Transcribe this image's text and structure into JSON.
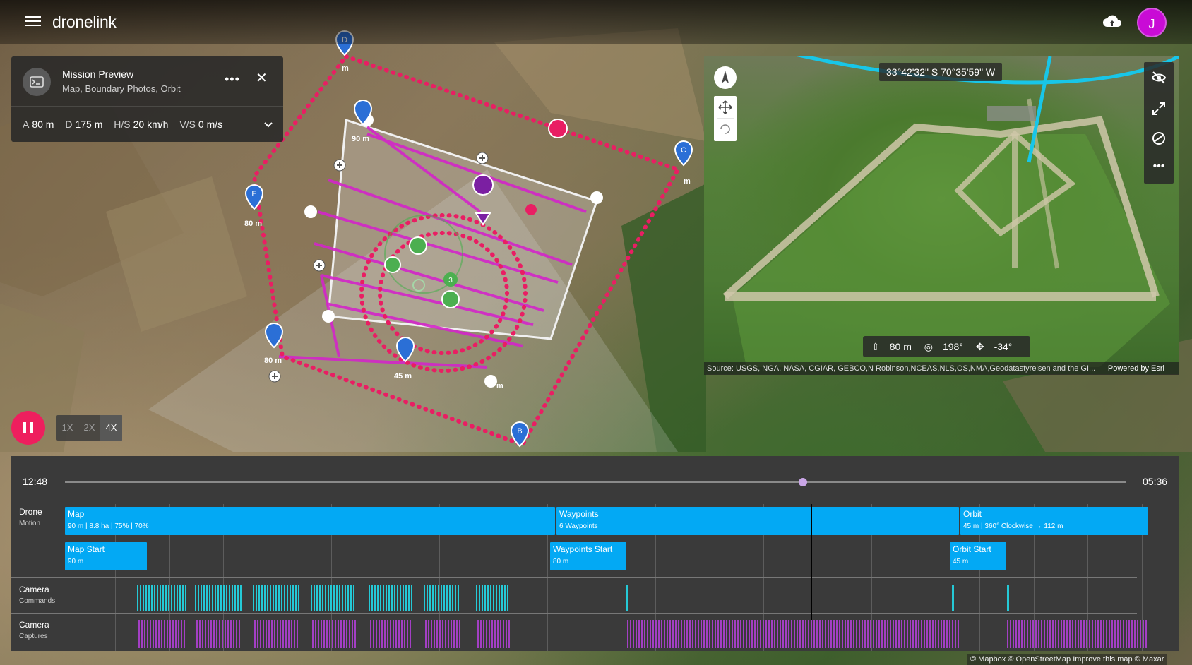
{
  "app": {
    "brand": "dronelink",
    "avatar_initial": "J",
    "colors": {
      "accent": "#03a9f4",
      "route": "#e91e63",
      "path": "#c02bd8",
      "pause": "#ee1f5e",
      "avatar": "#c90bd6"
    }
  },
  "mission": {
    "title": "Mission Preview",
    "subtitle": "Map, Boundary Photos, Orbit",
    "stats": [
      {
        "key": "A",
        "value": "80 m"
      },
      {
        "key": "D",
        "value": "175 m"
      },
      {
        "key": "H/S",
        "value": "20 km/h"
      },
      {
        "key": "V/S",
        "value": "0 m/s"
      }
    ]
  },
  "map": {
    "labels": {
      "m1": "m",
      "m2": "90 m",
      "m3": "80 m",
      "m4": "80 m",
      "m5": "45 m",
      "m6": "m",
      "m7": "m"
    },
    "markers": [
      "D",
      "C",
      "E",
      "B"
    ],
    "orbit_number": "3",
    "attribution": "© Mapbox © OpenStreetMap Improve this map © Maxar"
  },
  "preview": {
    "coords": "33°42'32\" S 70°35'59\" W",
    "hud": {
      "altitude": "80 m",
      "heading": "198°",
      "gimbal": "-34°"
    },
    "attribution_left": "Source: USGS, NGA, NASA, CGIAR, GEBCO,N Robinson,NCEAS,NLS,OS,NMA,Geodatastyrelsen and the GI...",
    "attribution_right": "Powered by Esri"
  },
  "playback": {
    "speeds": [
      "1X",
      "2X",
      "4X"
    ],
    "active_speed": "4X",
    "time_elapsed": "12:48",
    "time_total": "05:36",
    "progress": 0.696
  },
  "timeline": {
    "tracks": [
      {
        "title": "Drone",
        "subtitle": "Motion"
      },
      {
        "title": "Camera",
        "subtitle": "Commands"
      },
      {
        "title": "Camera",
        "subtitle": "Captures"
      }
    ],
    "segments": [
      {
        "title": "Map",
        "detail": "90 m | 8.8 ha | 75% | 70%"
      },
      {
        "title": "Waypoints",
        "detail": "6 Waypoints"
      },
      {
        "title": "Orbit",
        "detail": "45 m | 360° Clockwise → 112 m"
      },
      {
        "title": "Map Start",
        "detail": "90 m"
      },
      {
        "title": "Waypoints Start",
        "detail": "80 m"
      },
      {
        "title": "Orbit Start",
        "detail": "45 m"
      }
    ]
  }
}
